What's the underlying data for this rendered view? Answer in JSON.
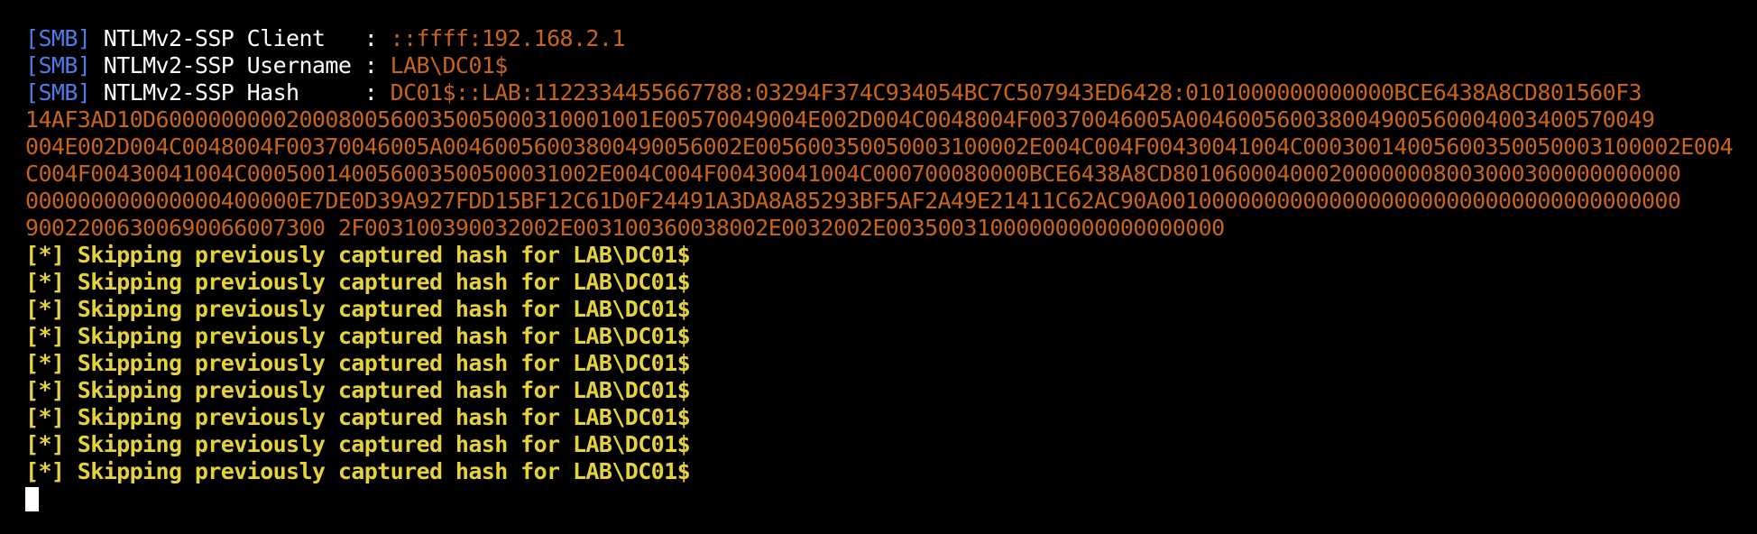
{
  "terminal": {
    "colors": {
      "background": "#000000",
      "tag": "#4d7de8",
      "label": "#ffffff",
      "value": "#c8641c",
      "skip": "#e6d23a",
      "cursor": "#ffffff"
    },
    "smb_lines": [
      {
        "tag": "[SMB]",
        "label": " NTLMv2-SSP Client   : ",
        "value": "::ffff:192.168.2.1"
      },
      {
        "tag": "[SMB]",
        "label": " NTLMv2-SSP Username : ",
        "value": "LAB\\DC01$"
      },
      {
        "tag": "[SMB]",
        "label": " NTLMv2-SSP Hash     : ",
        "value": "DC01$::LAB:1122334455667788:03294F374C934054BC7C507943ED6428:0101000000000000BCE6438A8CD801560F3"
      }
    ],
    "hash_continuation": [
      "14AF3AD10D60000000002000800560035005000310001001E00570049004E002D004C0048004F00370046005A004600560038004900560004003400570049",
      "004E002D004C0048004F00370046005A00460056003800490056002E005600350050003100002E004C004F00430041004C00030014005600350050003100002E004",
      "C004F00430041004C000500140056003500500031002E004C004F00430041004C000700080000BCE6438A8CD801060004000200000008003000300000000000",
      "000000000000000400000E7DE0D39A927FDD15BF12C61D0F24491A3DA8A85293BF5AF2A49E21411C62AC90A0010000000000000000000000000000000000000",
      "90022006300690066007300 2F003100390032002E003100360038002E0032002E00350031000000000000000000"
    ],
    "skip_message": "[*] Skipping previously captured hash for LAB\\DC01$",
    "skip_count": 9
  }
}
